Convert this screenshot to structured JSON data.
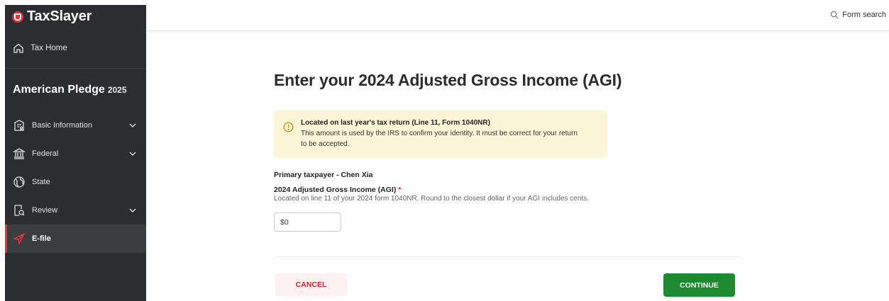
{
  "brand": {
    "name": "TaxSlayer"
  },
  "sidebar": {
    "home_label": "Tax Home",
    "pledge_name": "American Pledge",
    "pledge_year": "2025",
    "items": [
      {
        "label": "Basic Information",
        "icon": "building-person-icon",
        "expandable": true
      },
      {
        "label": "Federal",
        "icon": "bank-icon",
        "expandable": true
      },
      {
        "label": "State",
        "icon": "globe-icon",
        "expandable": false
      },
      {
        "label": "Review",
        "icon": "document-search-icon",
        "expandable": true
      },
      {
        "label": "E-file",
        "icon": "paper-plane-icon",
        "expandable": false,
        "active": true
      }
    ]
  },
  "header": {
    "search_label": "Form search"
  },
  "main": {
    "title": "Enter your 2024 Adjusted Gross Income (AGI)",
    "alert": {
      "heading": "Located on last year's tax return (Line 11, Form 1040NR)",
      "body": "This amount is used by the IRS to confirm your identity. It must be correct for your return to be accepted."
    },
    "section_title": "Primary taxpayer - Chen Xia",
    "field": {
      "label": "2024 Adjusted Gross Income (AGI)",
      "required_mark": "*",
      "help": "Located on line 11 of your 2024 form 1040NR. Round to the closest dollar if your AGI includes cents.",
      "value": "$0"
    },
    "cancel_label": "CANCEL",
    "continue_label": "CONTINUE"
  },
  "colors": {
    "sidebar_bg": "#2b2d30",
    "brand_red": "#e0343c",
    "alert_bg": "#fdf5d7",
    "continue_green": "#1e8a2f",
    "cancel_red": "#d0202a"
  }
}
